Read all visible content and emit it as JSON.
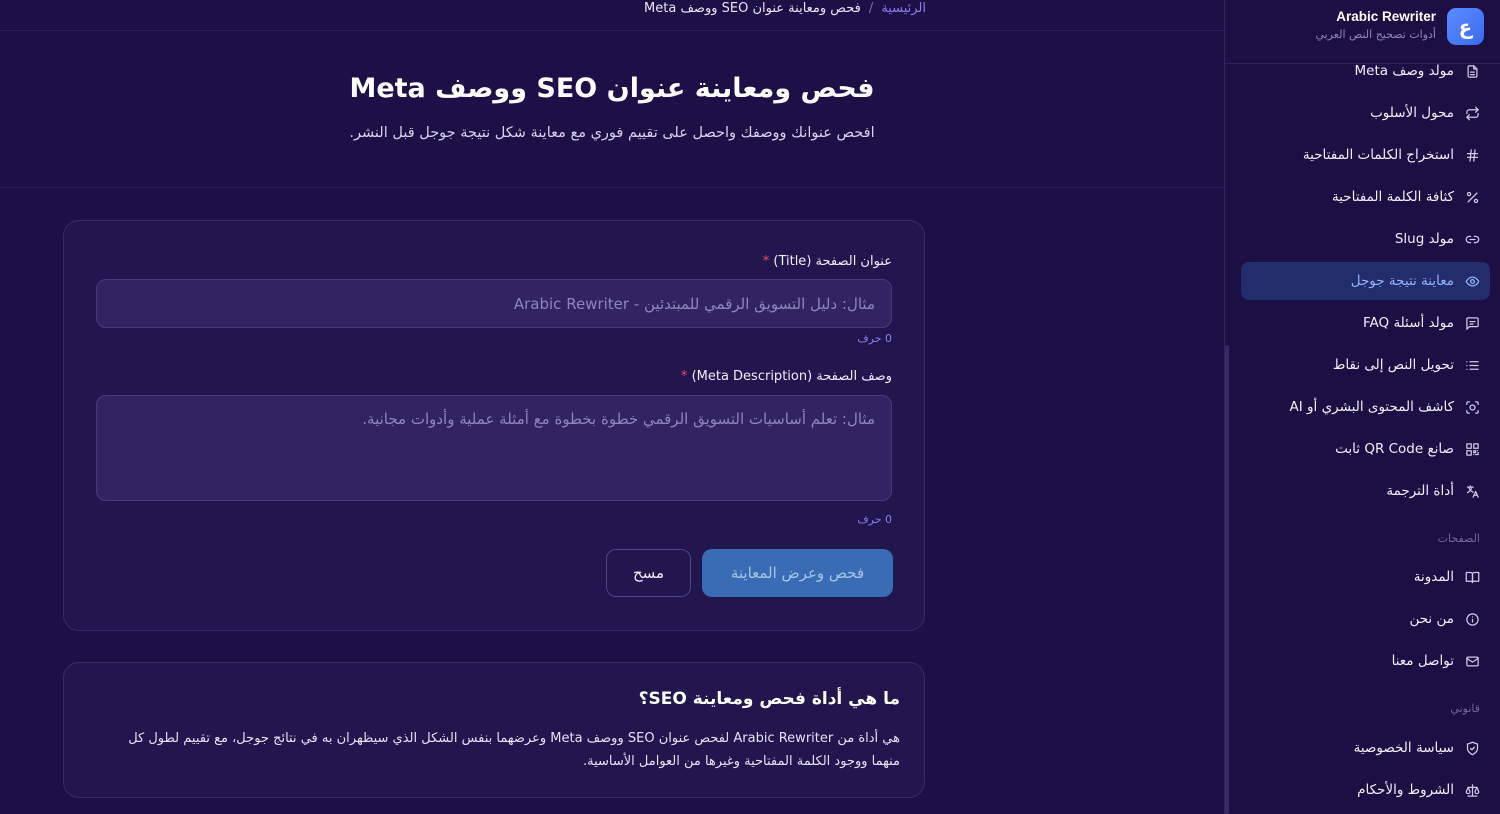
{
  "brand": {
    "logo_letter": "ع",
    "name": "Arabic Rewriter",
    "subtitle": "أدوات تصحيح النص العربي"
  },
  "breadcrumb": {
    "home": "الرئيسية",
    "separator": "/",
    "current": "فحص ومعاينة عنوان SEO ووصف Meta"
  },
  "hero": {
    "title": "فحص ومعاينة عنوان SEO ووصف Meta",
    "subtitle": "افحص عنوانك ووصفك واحصل على تقييم فوري مع معاينة شكل نتيجة جوجل قبل النشر."
  },
  "form": {
    "title_label": "عنوان الصفحة (Title)",
    "title_placeholder": "مثال: دليل التسويق الرقمي للمبتدئين - Arabic Rewriter",
    "title_value": "",
    "title_counter": "0 حرف",
    "desc_label": "وصف الصفحة (Meta Description)",
    "desc_placeholder": "مثال: تعلم أساسيات التسويق الرقمي خطوة بخطوة مع أمثلة عملية وأدوات مجانية.",
    "desc_value": "",
    "desc_counter": "0 حرف",
    "required_mark": "*",
    "submit_label": "فحص وعرض المعاينة",
    "clear_label": "مسح"
  },
  "info": {
    "heading": "ما هي أداة فحص ومعاينة SEO؟",
    "body": "هي أداة من Arabic Rewriter لفحص عنوان SEO ووصف Meta وعرضهما بنفس الشكل الذي سيظهران به في نتائج جوجل، مع تقييم لطول كل منهما ووجود الكلمة المفتاحية وغيرها من العوامل الأساسية."
  },
  "sidebar": {
    "tools": [
      {
        "label": "مولد وصف Meta",
        "icon": "document-icon"
      },
      {
        "label": "محول الأسلوب",
        "icon": "repeat-icon"
      },
      {
        "label": "استخراج الكلمات المفتاحية",
        "icon": "hash-icon"
      },
      {
        "label": "كثافة الكلمة المفتاحية",
        "icon": "percent-icon"
      },
      {
        "label": "مولد Slug",
        "icon": "link-icon"
      },
      {
        "label": "معاينة نتيجة جوجل",
        "icon": "eye-icon",
        "active": true
      },
      {
        "label": "مولد أسئلة FAQ",
        "icon": "message-icon"
      },
      {
        "label": "تحويل النص إلى نقاط",
        "icon": "list-icon"
      },
      {
        "label": "كاشف المحتوى البشري أو AI",
        "icon": "scan-icon"
      },
      {
        "label": "صانع QR Code ثابت",
        "icon": "qr-icon"
      },
      {
        "label": "أداة الترجمة",
        "icon": "translate-icon"
      }
    ],
    "pages_label": "الصفحات",
    "pages": [
      {
        "label": "المدونة",
        "icon": "book-icon"
      },
      {
        "label": "من نحن",
        "icon": "info-icon"
      },
      {
        "label": "تواصل معنا",
        "icon": "mail-icon"
      }
    ],
    "legal_label": "قانوني",
    "legal": [
      {
        "label": "سياسة الخصوصية",
        "icon": "shield-icon"
      },
      {
        "label": "الشروط والأحكام",
        "icon": "scale-icon"
      }
    ]
  },
  "colors": {
    "background": "#1c1046",
    "card": "#21164d",
    "accent": "#8a7df2",
    "active_item": "#232d6c",
    "primary_button": "#3a6bb5",
    "required": "#ef4d6c"
  }
}
